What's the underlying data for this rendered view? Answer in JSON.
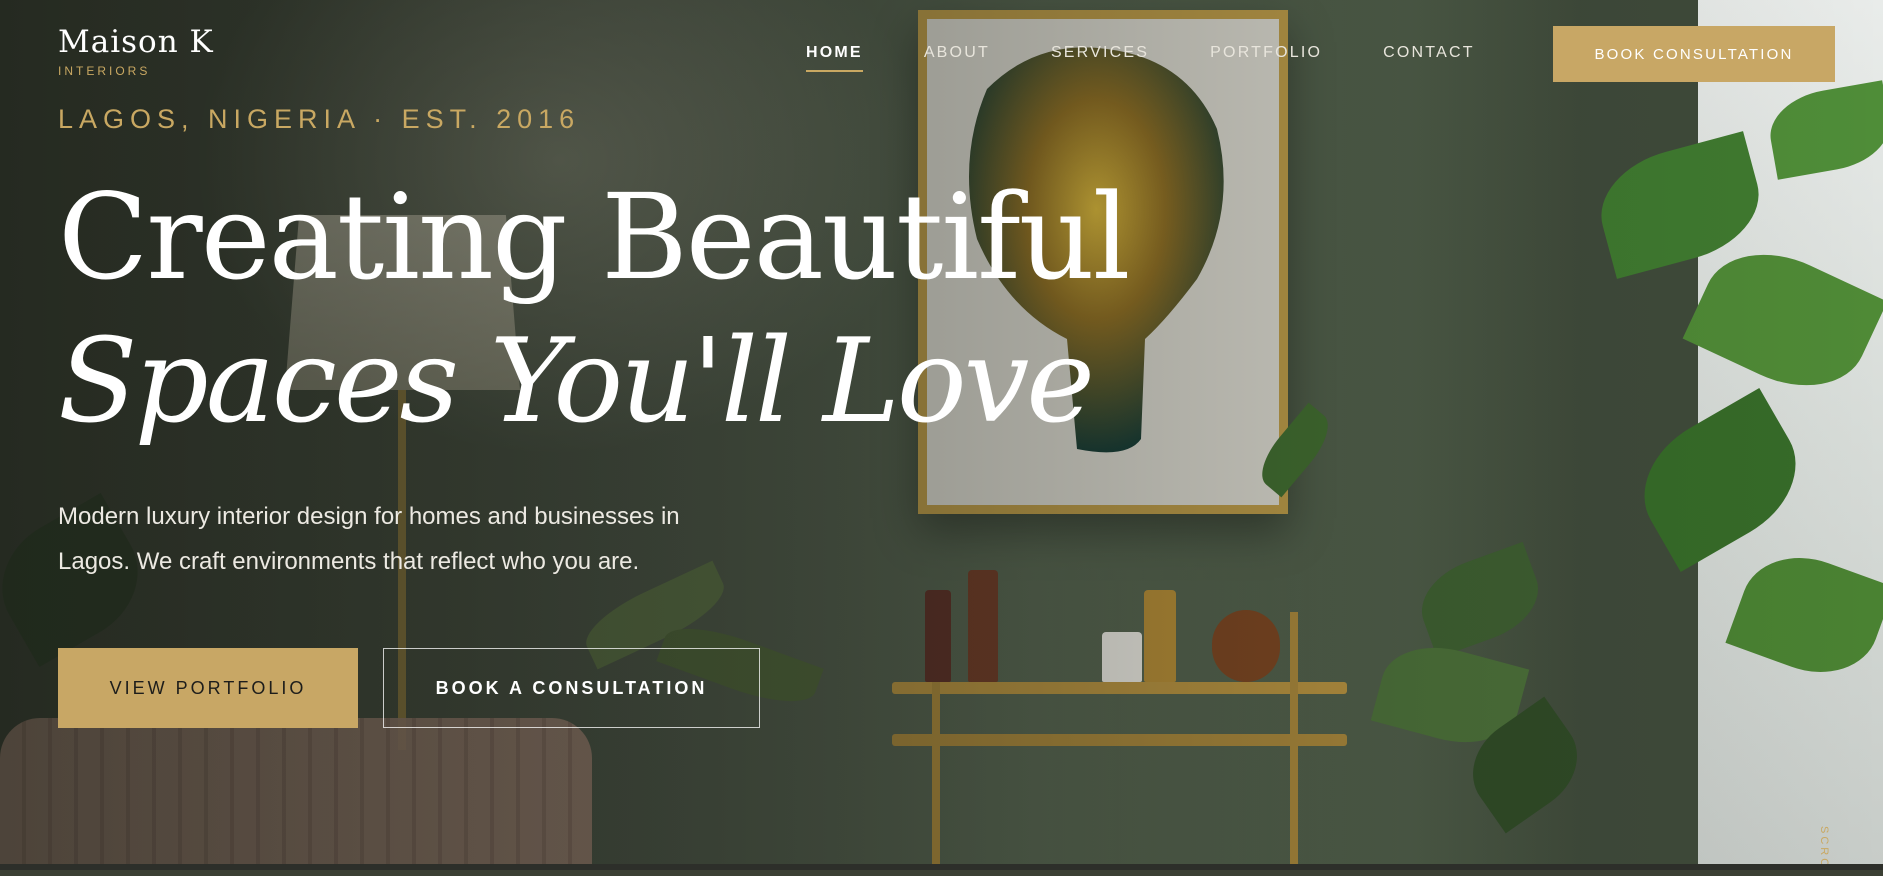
{
  "brand": {
    "name": "Maison K",
    "tagline": "INTERIORS"
  },
  "nav": {
    "items": [
      {
        "label": "HOME",
        "active": true
      },
      {
        "label": "ABOUT",
        "active": false
      },
      {
        "label": "SERVICES",
        "active": false
      },
      {
        "label": "PORTFOLIO",
        "active": false
      },
      {
        "label": "CONTACT",
        "active": false
      }
    ],
    "cta_label": "BOOK CONSULTATION"
  },
  "hero": {
    "eyebrow": "LAGOS, NIGERIA · EST. 2016",
    "headline_line1": "Creating Beautiful",
    "headline_line2": "Spaces You'll Love",
    "lead": "Modern luxury interior design for homes and businesses in Lagos. We craft environments that reflect who you are.",
    "primary_button": "VIEW PORTFOLIO",
    "secondary_button": "BOOK A CONSULTATION",
    "scroll_hint": "SCROLL"
  },
  "colors": {
    "accent_gold": "#c8a765",
    "wall_green": "#4d5b47",
    "text_light": "#ece9e2"
  }
}
